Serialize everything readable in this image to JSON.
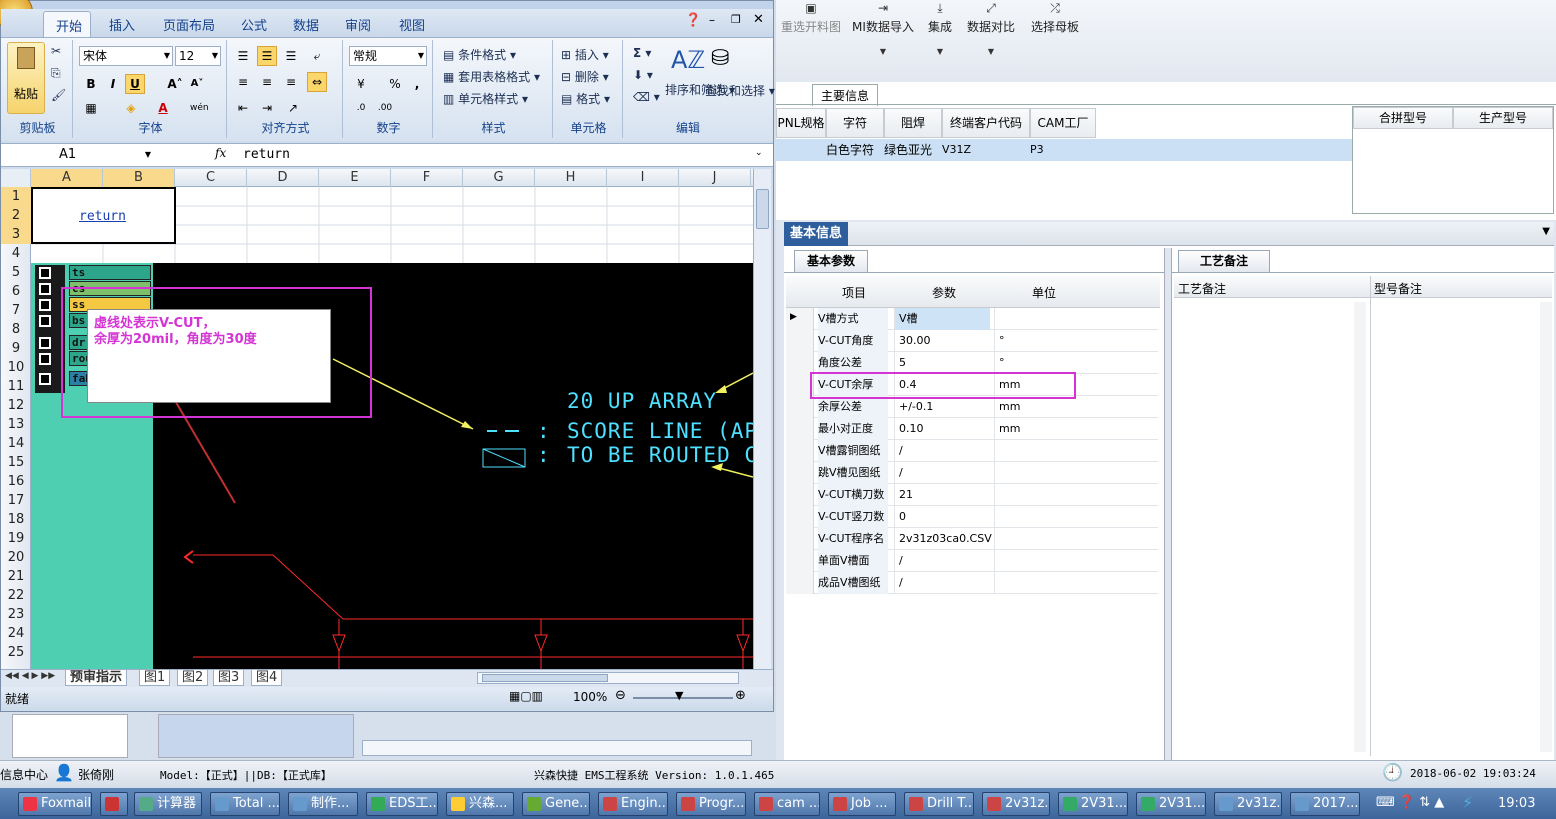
{
  "ems": {
    "toolbar": [
      {
        "label": "重选开料图",
        "icon": "image-icon",
        "dropdown": false
      },
      {
        "label": "MI数据导入",
        "icon": "import-icon",
        "dropdown": true
      },
      {
        "label": "集成",
        "icon": "download-icon",
        "dropdown": true
      },
      {
        "label": "数据对比",
        "icon": "compare-icon",
        "dropdown": true
      },
      {
        "label": "选择母板",
        "icon": "shuffle-icon",
        "dropdown": false
      }
    ],
    "main_info_tab": "主要信息",
    "main_headers": [
      "PNL规格",
      "字符",
      "阻焊",
      "终端客户代码",
      "CAM工厂"
    ],
    "main_row": [
      "",
      "白色字符",
      "绿色亚光",
      "V31Z",
      "P3"
    ],
    "side_headers": [
      "合拼型号",
      "生产型号"
    ],
    "basic_info": "基本信息",
    "basic_params_tab": "基本参数",
    "craft_note_tab": "工艺备注",
    "param_headers": [
      "项目",
      "参数",
      "单位"
    ],
    "params": [
      {
        "item": "V槽方式",
        "value": "V槽",
        "unit": ""
      },
      {
        "item": "V-CUT角度",
        "value": "30.00",
        "unit": "°"
      },
      {
        "item": "角度公差",
        "value": "5",
        "unit": "°"
      },
      {
        "item": "V-CUT余厚",
        "value": "0.4",
        "unit": "mm"
      },
      {
        "item": "余厚公差",
        "value": "+/-0.1",
        "unit": "mm"
      },
      {
        "item": "最小对正度",
        "value": "0.10",
        "unit": "mm"
      },
      {
        "item": "V槽露铜图纸",
        "value": "/",
        "unit": ""
      },
      {
        "item": "跳V槽见图纸",
        "value": "/",
        "unit": ""
      },
      {
        "item": "V-CUT横刀数",
        "value": "21",
        "unit": ""
      },
      {
        "item": "V-CUT竖刀数",
        "value": "0",
        "unit": ""
      },
      {
        "item": "V-CUT程序名",
        "value": "2v31z03ca0.CSV",
        "unit": ""
      },
      {
        "item": "单面V槽面",
        "value": "/",
        "unit": ""
      },
      {
        "item": "成品V槽图纸",
        "value": "/",
        "unit": ""
      }
    ],
    "note_headers": [
      "工艺备注",
      "型号备注"
    ]
  },
  "excel": {
    "tabs": [
      "开始",
      "插入",
      "页面布局",
      "公式",
      "数据",
      "审阅",
      "视图"
    ],
    "active_tab": "开始",
    "groups": {
      "clipboard": "剪贴板",
      "font": "字体",
      "align": "对齐方式",
      "number": "数字",
      "style": "样式",
      "cell": "单元格",
      "edit": "编辑"
    },
    "paste": "粘贴",
    "font_name": "宋体",
    "font_size": "12",
    "number_format": "常规",
    "style_items": [
      "条件格式",
      "套用表格格式",
      "单元格样式"
    ],
    "cell_items": [
      "插入",
      "删除",
      "格式"
    ],
    "edit_items": [
      "排序和筛选",
      "查找和选择"
    ],
    "name_box": "A1",
    "fx": "fx",
    "formula": "return",
    "columns": [
      "A",
      "B",
      "C",
      "D",
      "E",
      "F",
      "G",
      "H",
      "I",
      "J"
    ],
    "rows": [
      "1",
      "2",
      "3",
      "4",
      "5",
      "6",
      "7",
      "8",
      "9",
      "10",
      "11",
      "12",
      "13",
      "14",
      "15",
      "16",
      "17",
      "18",
      "19",
      "20",
      "21",
      "22",
      "23",
      "24",
      "25"
    ],
    "cell_link": "return",
    "layer_names": [
      "ts",
      "cs",
      "ss",
      "bs",
      "dr",
      "rou",
      "fab"
    ],
    "annotation_line1": "虚线处表示V-CUT，",
    "annotation_line2": "余厚为20mil，角度为30度",
    "cad_lines": [
      "20 UP ARRAY",
      "SCORE LINE (AP",
      "TO BE ROUTED C"
    ],
    "cad_colon": ":",
    "sheet_tabs": [
      "预审指示",
      "图1",
      "图2",
      "图3",
      "图4"
    ],
    "status": "就绪",
    "zoom": "100%"
  },
  "appstatus": {
    "info_center": "信息中心",
    "user": "张倚刚",
    "model": "Model:【正式】||DB:【正式库】",
    "title": "兴森快捷 EMS工程系统 Version: 1.0.1.465",
    "datetime": "2018-06-02 19:03:24"
  },
  "taskbar": {
    "items": [
      "Foxmail",
      "",
      "计算器",
      "Total ...",
      "制作...",
      "EDS工...",
      "兴森...",
      "Gene...",
      "Engin...",
      "Progr...",
      "cam ...",
      "Job ...",
      "Drill T...",
      "2v31z...",
      "2V31...",
      "2V31...",
      "2v31z...",
      "2017..."
    ],
    "clock": "19:03"
  }
}
